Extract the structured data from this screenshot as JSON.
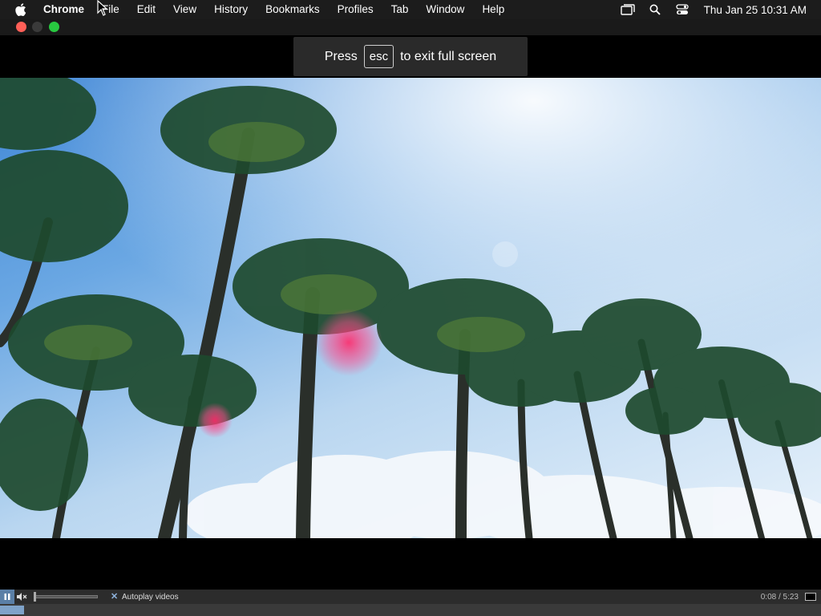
{
  "menubar": {
    "app_name": "Chrome",
    "items": [
      "File",
      "Edit",
      "View",
      "History",
      "Bookmarks",
      "Profiles",
      "Tab",
      "Window",
      "Help"
    ],
    "clock": "Thu Jan 25  10:31 AM",
    "status_icons": [
      "display-icon",
      "spotlight-search-icon",
      "control-center-icon"
    ]
  },
  "window": {
    "controls": {
      "close_color": "#ff5f57",
      "minimize_color": "#3a3a3a",
      "zoom_color": "#28c840"
    }
  },
  "fullscreen_banner": {
    "prefix": "Press",
    "key": "esc",
    "suffix": "to exit full screen"
  },
  "video": {
    "description_icon": "video-frame",
    "controls": {
      "autoplay_label": "Autoplay videos",
      "time": "0:08 / 5:23",
      "progress_fraction": 0.025,
      "volume_fraction": 0.0
    }
  }
}
